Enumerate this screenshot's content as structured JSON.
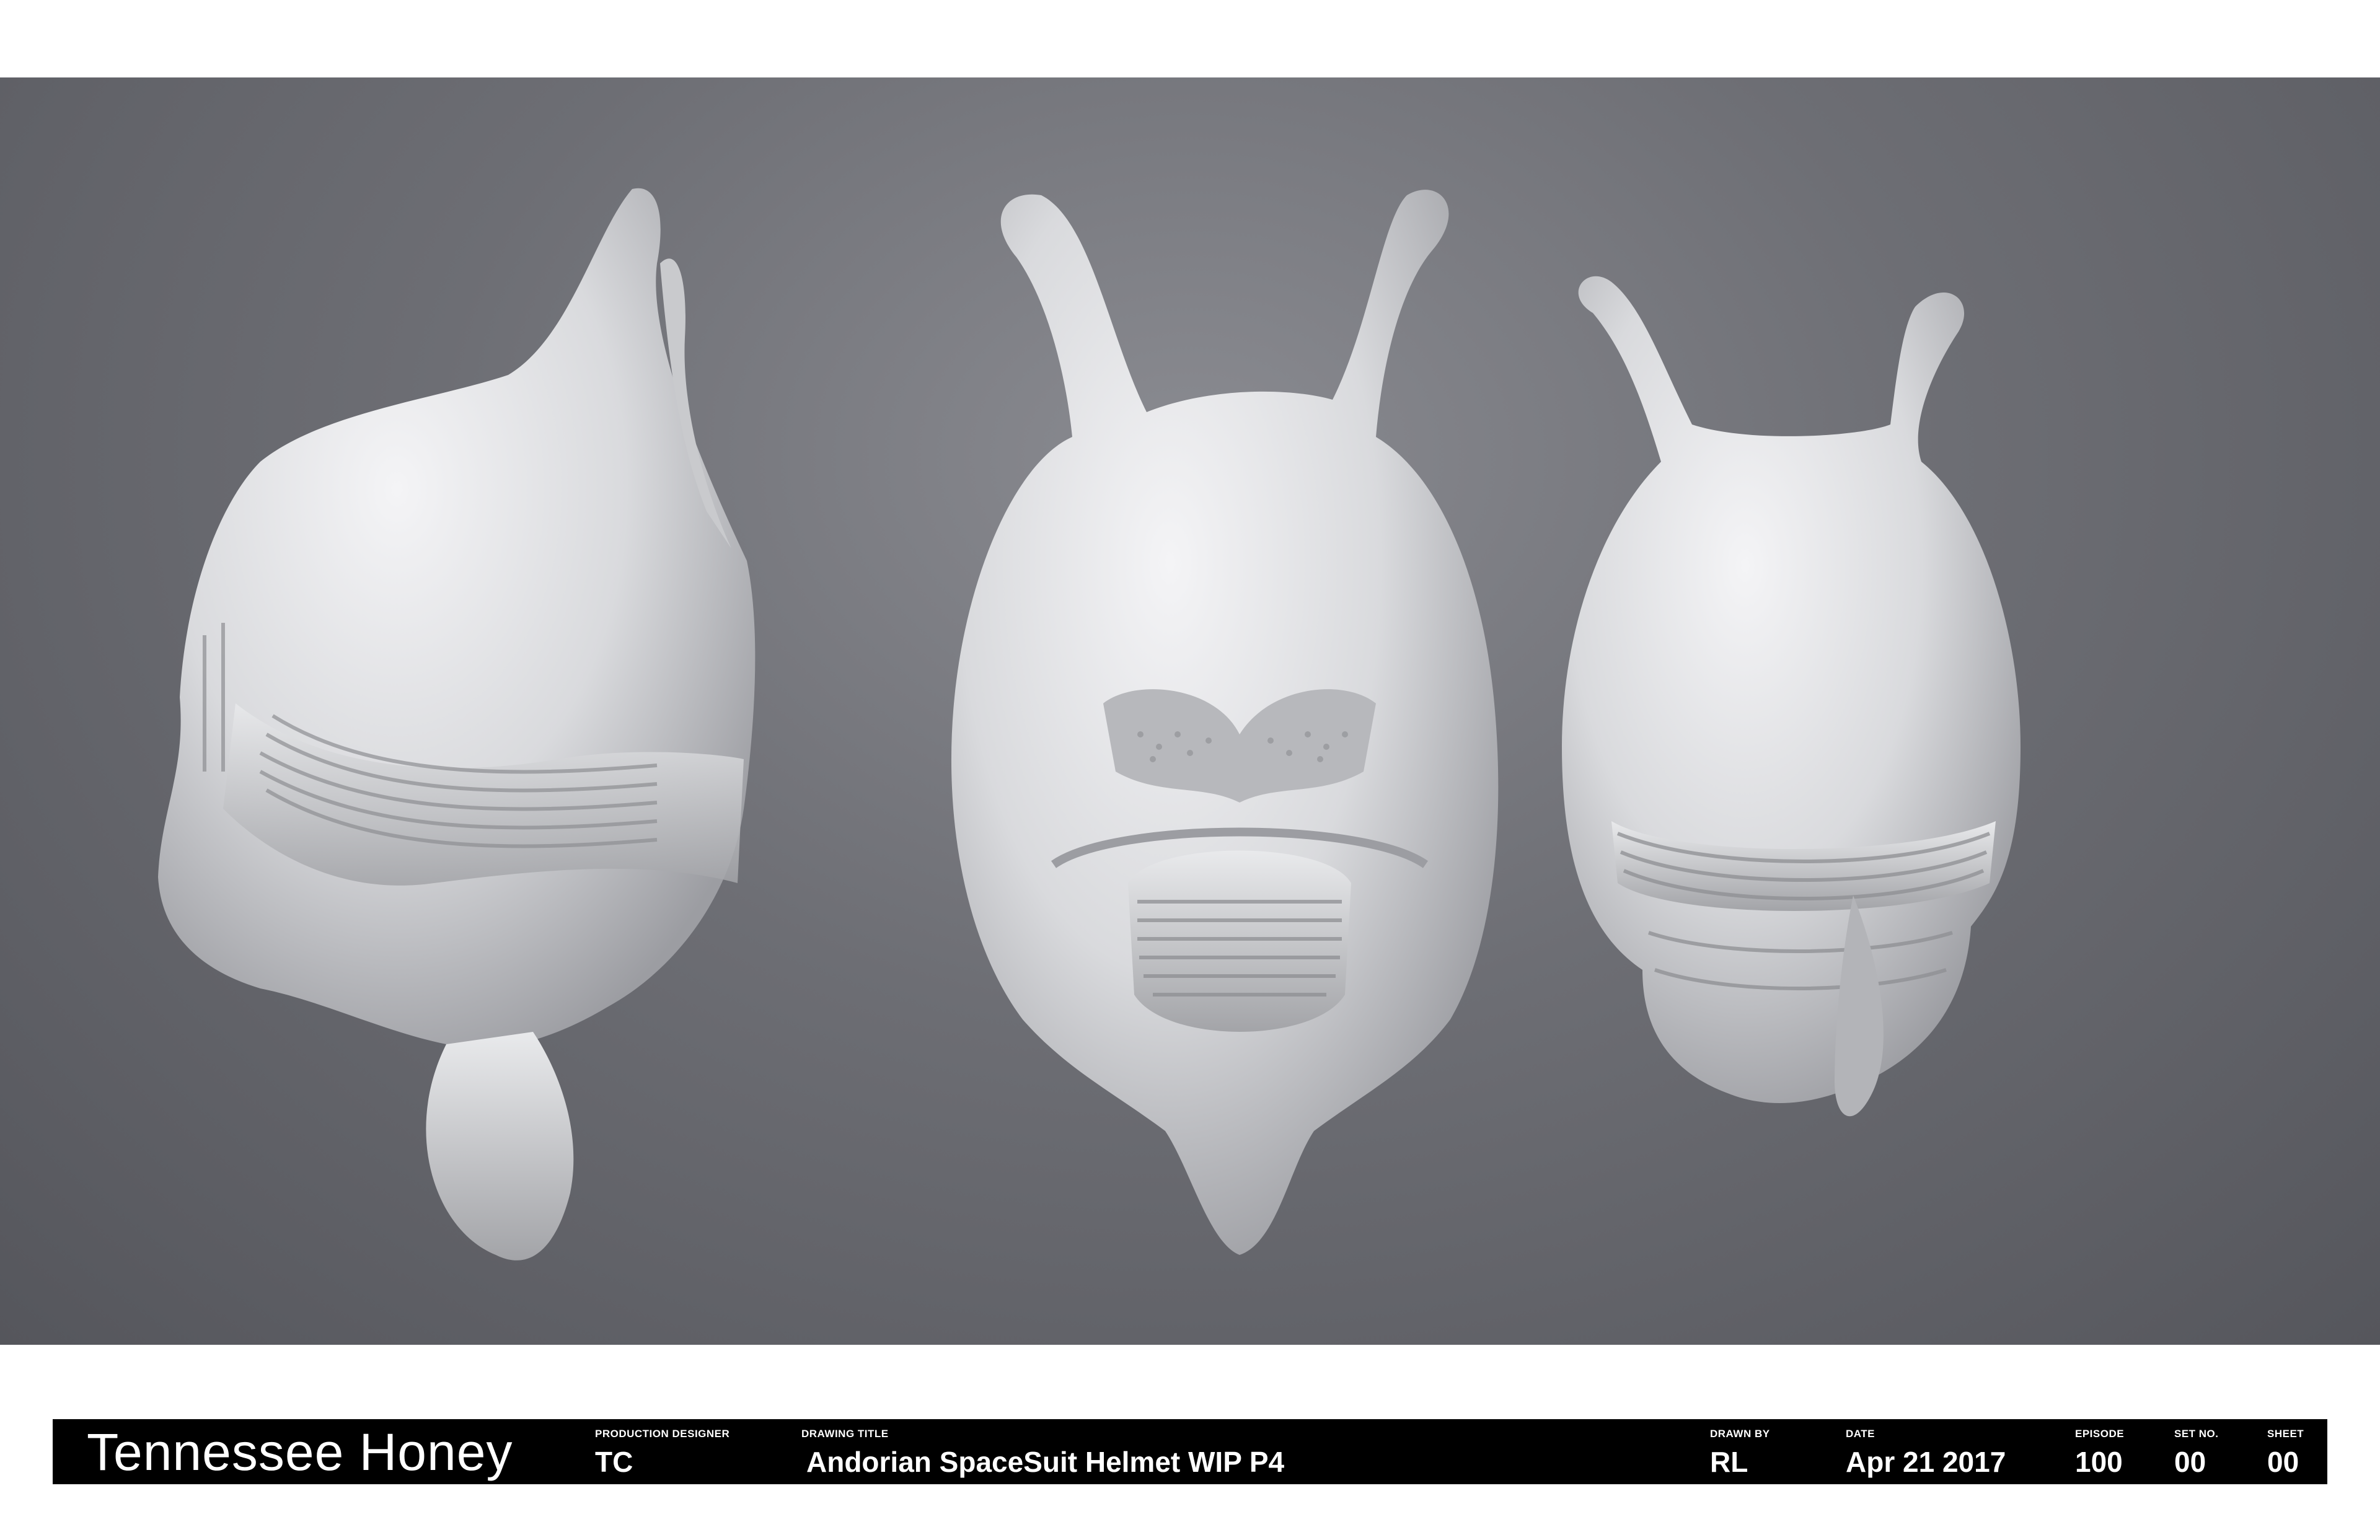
{
  "scene": {
    "background_color": "#6a6b71",
    "model_color": "#e6e7ea",
    "views": [
      "helmet-side-view",
      "helmet-front-view",
      "helmet-back-view"
    ]
  },
  "title_block": {
    "project_name": "Tennessee Honey",
    "production_designer": {
      "label": "PRODUCTION DESIGNER",
      "value": "TC"
    },
    "drawing_title": {
      "label": "DRAWING TITLE",
      "value": "Andorian SpaceSuit Helmet  WIP P4"
    },
    "drawn_by": {
      "label": "DRAWN BY",
      "value": "RL"
    },
    "date": {
      "label": "DATE",
      "value": "Apr 21 2017"
    },
    "episode": {
      "label": "EPISODE",
      "value": "100"
    },
    "set_no": {
      "label": "SET NO.",
      "value": "00"
    },
    "sheet": {
      "label": "SHEET",
      "value": "00"
    }
  }
}
